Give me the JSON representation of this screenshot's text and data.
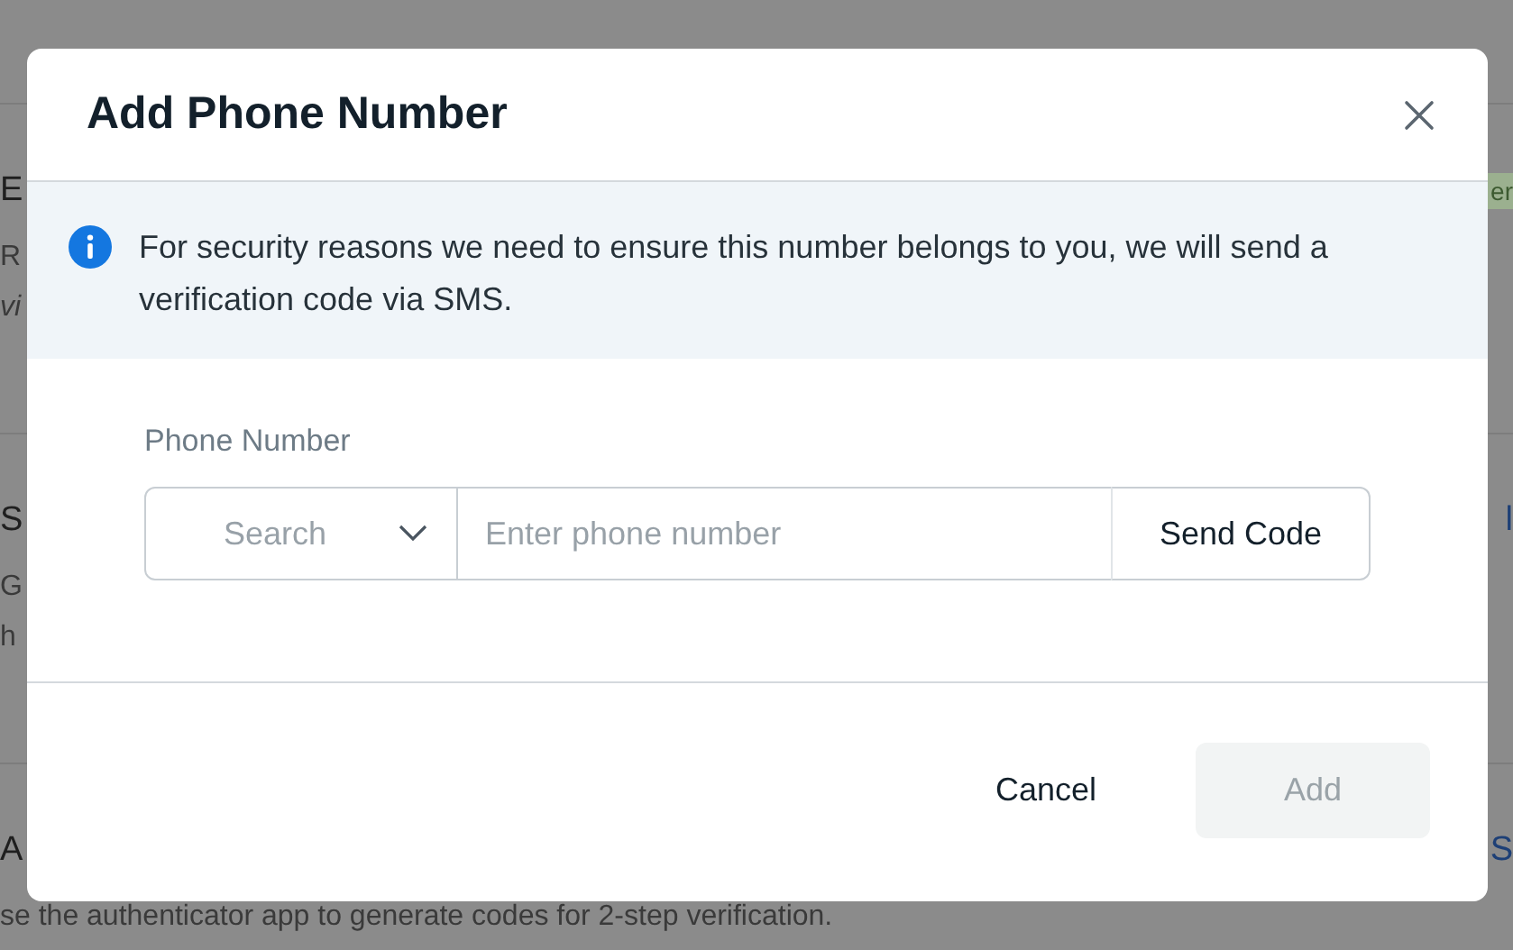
{
  "backdrop": {
    "sections": [
      {
        "heading": "E",
        "lines": [
          {
            "text": "R",
            "italic": false
          },
          {
            "text": "vi",
            "italic": true
          }
        ],
        "action": {
          "text": "er",
          "kind": "badge"
        }
      },
      {
        "heading": "S",
        "lines": [
          {
            "text": "G",
            "italic": false
          },
          {
            "text": "h",
            "italic": false
          }
        ],
        "action": {
          "text": "l",
          "kind": "link"
        }
      },
      {
        "heading": "A",
        "lines": [
          {
            "text": "se the authenticator app to generate codes for 2-step verification.",
            "italic": false
          }
        ],
        "action": {
          "text": "S",
          "kind": "link"
        }
      }
    ]
  },
  "dialog": {
    "title": "Add Phone Number",
    "notice": "For security reasons we need to ensure this number belongs to you, we will send a verification code via SMS.",
    "phone": {
      "label": "Phone Number",
      "country": {
        "placeholder": "Search",
        "expanded": false
      },
      "number": {
        "placeholder": "Enter phone number"
      },
      "send_button": "Send Code"
    },
    "buttons": [
      {
        "label": "Cancel",
        "kind": "text",
        "disabled": false
      },
      {
        "label": "Add",
        "kind": "primary",
        "disabled": true
      }
    ]
  }
}
